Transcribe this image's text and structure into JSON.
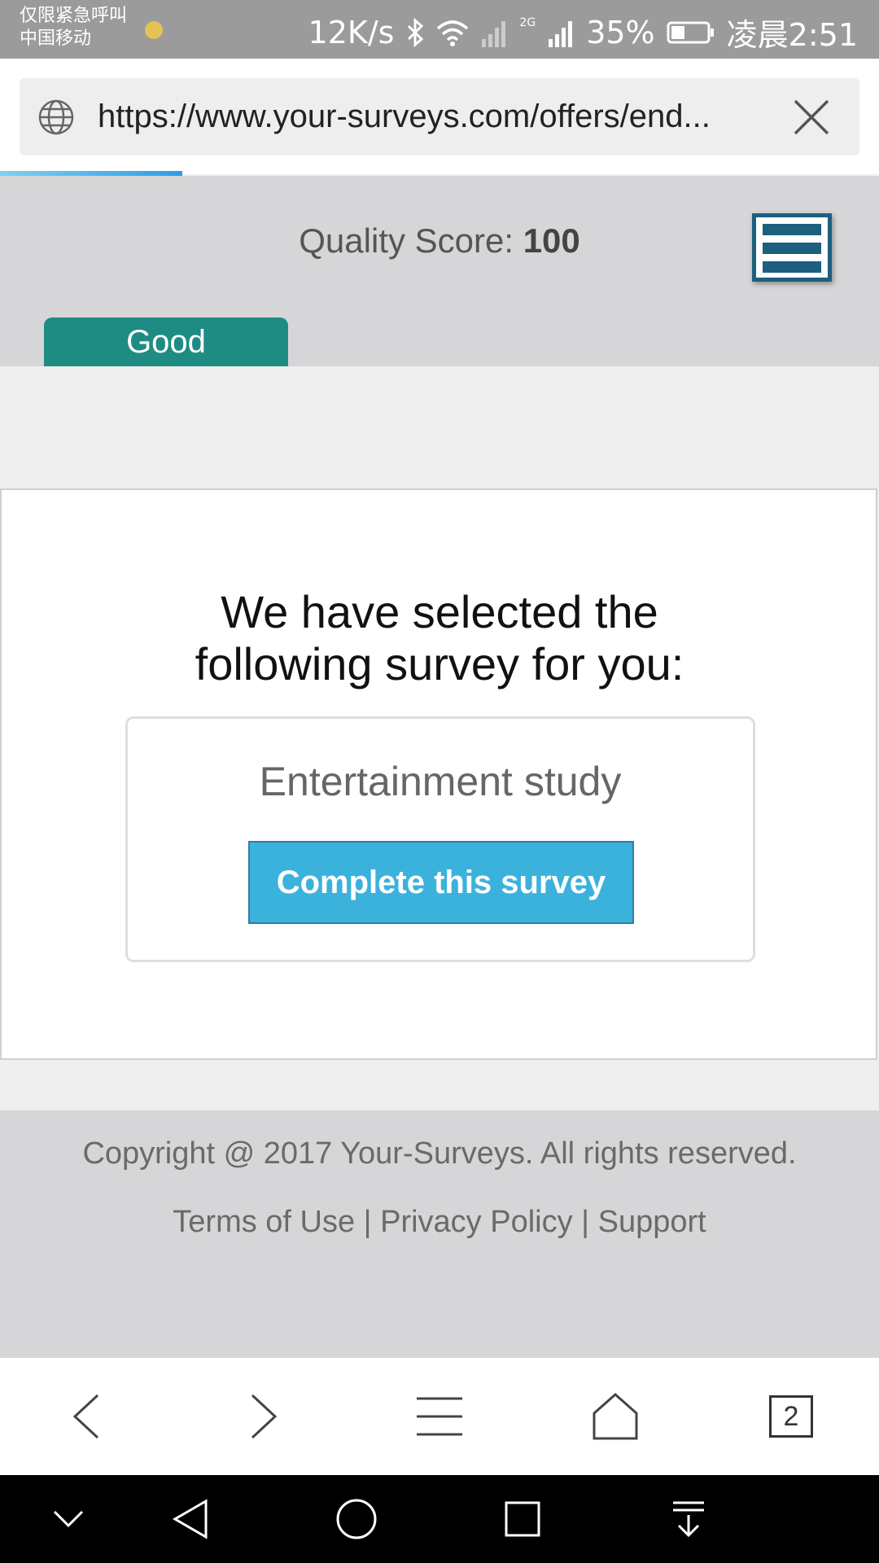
{
  "status_bar": {
    "carrier_line1": "仅限紧急呼叫",
    "carrier_line2": "中国移动",
    "speed": "12K/s",
    "network_tag": "2G",
    "battery": "35%",
    "time": "凌晨2:51"
  },
  "browser": {
    "url": "https://www.your-surveys.com/offers/end...",
    "tab_count": "2"
  },
  "header": {
    "quality_label": "Quality Score:",
    "quality_value": "100",
    "rating_tab": "Good"
  },
  "main": {
    "headline_line1": "We have selected the",
    "headline_line2": "following survey for you:",
    "survey_name": "Entertainment study",
    "complete_button": "Complete this survey"
  },
  "footer": {
    "copyright": "Copyright @ 2017 Your-Surveys. All rights reserved.",
    "links": [
      "Terms of Use",
      "Privacy Policy",
      "Support"
    ],
    "separator": "|"
  },
  "colors": {
    "accent": "#3bb2dc",
    "good_tab": "#1f8c83",
    "menu_icon": "#1c5f7e"
  }
}
